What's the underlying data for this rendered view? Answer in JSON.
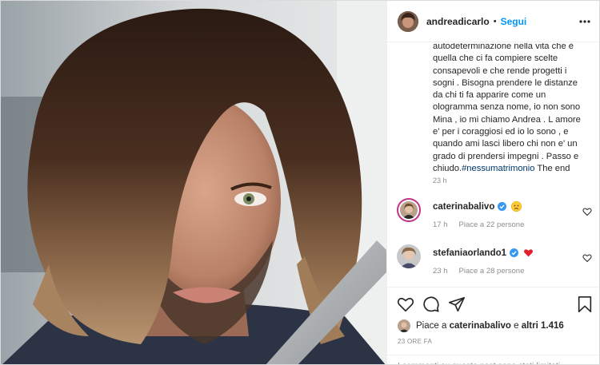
{
  "post": {
    "image_alt": "",
    "author": {
      "username": "andreadicarlo",
      "separator": "•",
      "follow_label": "Segui",
      "more_label": "• • •"
    },
    "caption": {
      "text": "autodeterminazione nella vita che è quella che ci fa compiere scelte consapevoli e che rende progetti i sogni . Bisogna prendere le distanze da chi ti fa apparire come un ologramma senza nome, io non sono Mina , io mi chiamo Andrea . L amore e' per i coraggiosi ed io lo sono , e quando ami lasci libero chi non e' un grado di prendersi impegni . Passo e chiudo.",
      "hashtag": "#nessumatrimonio",
      "suffix": " The end",
      "time": "23 h"
    },
    "comments": [
      {
        "username": "caterinabalivo",
        "verified": true,
        "emoji": "worried-face",
        "time": "17 h",
        "likes": "Piace a 22 persone"
      },
      {
        "username": "stefaniaorlando1",
        "verified": true,
        "emoji": "red-heart",
        "time": "23 h",
        "likes": "Piace a 28 persone"
      }
    ],
    "liked_by": {
      "prefix": "Piace a ",
      "user": "caterinabalivo",
      "middle": " e ",
      "others": "altri 1.416"
    },
    "timestamp": "23 ORE FA",
    "comments_notice": "I commenti su questo post sono stati limitati."
  },
  "icons": {
    "like": "heart-icon",
    "comment": "comment-icon",
    "share": "share-icon",
    "save": "bookmark-icon"
  },
  "colors": {
    "accent": "#0095f6",
    "hashtag": "#00376b",
    "muted": "#8e8e8e",
    "verified": "#3897f0",
    "heart": "#ed4956"
  }
}
